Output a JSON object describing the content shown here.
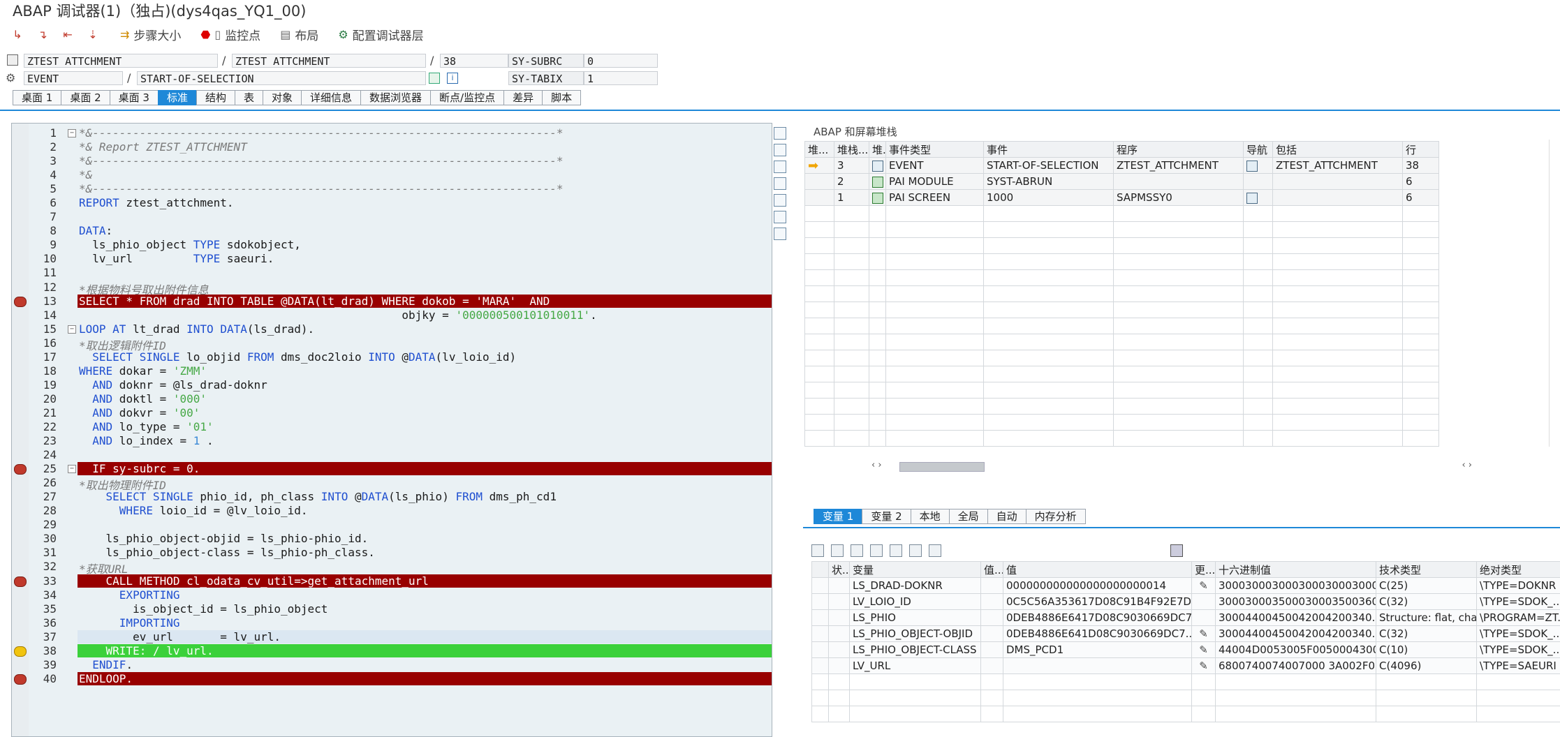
{
  "window": {
    "title": "ABAP 调试器(1)（独占)(dys4qas_YQ1_00)"
  },
  "toolbar": {
    "icons": [
      "step-into-icon",
      "step-over-icon",
      "return-icon",
      "continue-icon"
    ],
    "step_size": "步骤大小",
    "watchpoint": "监控点",
    "layout": "布局",
    "config": "配置调试器层"
  },
  "info": {
    "program1": "ZTEST_ATTCHMENT",
    "program2": "ZTEST_ATTCHMENT",
    "line": "38",
    "subrc_label": "SY-SUBRC",
    "subrc_value": "0",
    "event_type": "EVENT",
    "event": "START-OF-SELECTION",
    "tabix_label": "SY-TABIX",
    "tabix_value": "1"
  },
  "tabs": [
    "桌面 1",
    "桌面 2",
    "桌面 3",
    "标准",
    "结构",
    "表",
    "对象",
    "详细信息",
    "数据浏览器",
    "断点/监控点",
    "差异",
    "脚本"
  ],
  "active_tab": "标准",
  "code": [
    "*&---------------------------------------------------------------------*",
    "*& Report ZTEST_ATTCHMENT",
    "*&---------------------------------------------------------------------*",
    "*&",
    "*&---------------------------------------------------------------------*",
    "REPORT ztest_attchment.",
    "",
    "DATA:",
    "  ls_phio_object TYPE sdokobject,",
    "  lv_url         TYPE saeuri.",
    "",
    "*根据物料号取出附件信息",
    "SELECT * FROM drad INTO TABLE @DATA(lt_drad) WHERE dokob = 'MARA'  AND",
    "                                                objky = '000000500101010011'.",
    "LOOP AT lt_drad INTO DATA(ls_drad).",
    "*取出逻辑附件ID",
    "  SELECT SINGLE lo_objid FROM dms_doc2loio INTO @DATA(lv_loio_id)",
    "WHERE dokar = 'ZMM'",
    "  AND doknr = @ls_drad-doknr",
    "  AND doktl = '000'",
    "  AND dokvr = '00'",
    "  AND lo_type = '01'",
    "  AND lo_index = 1 .",
    "",
    "  IF sy-subrc = 0.",
    "*取出物理附件ID",
    "    SELECT SINGLE phio_id, ph_class INTO @DATA(ls_phio) FROM dms_ph_cd1",
    "      WHERE loio_id = @lv_loio_id.",
    "",
    "    ls_phio_object-objid = ls_phio-phio_id.",
    "    ls_phio_object-class = ls_phio-ph_class.",
    "*获取URL",
    "    CALL METHOD cl_odata_cv_util=>get_attachment_url",
    "      EXPORTING",
    "        is_object_id = ls_phio_object",
    "      IMPORTING",
    "        ev_url       = lv_url.",
    "    WRITE: / lv_url.",
    "  ENDIF.",
    "ENDLOOP."
  ],
  "stack": {
    "title": "ABAP 和屏幕堆栈",
    "headers": [
      "堆...",
      "堆栈...",
      "堆..",
      "事件类型",
      "事件",
      "程序",
      "导航",
      "包括",
      "行"
    ],
    "rows": [
      {
        "level": "3",
        "type": "EVENT",
        "event": "START-OF-SELECTION",
        "program": "ZTEST_ATTCHMENT",
        "include": "ZTEST_ATTCHMENT",
        "line": "38"
      },
      {
        "level": "2",
        "type": "PAI MODULE",
        "event": "SYST-ABRUN",
        "program": "",
        "include": "",
        "line": "6"
      },
      {
        "level": "1",
        "type": "PAI SCREEN",
        "event": "1000",
        "program": "SAPMSSY0",
        "include": "",
        "line": "6"
      }
    ]
  },
  "vartabs": [
    "变量 1",
    "变量 2",
    "本地",
    "全局",
    "自动",
    "内存分析"
  ],
  "active_vartab": "变量 1",
  "vars": {
    "headers": [
      "状...",
      "变量",
      "值...",
      "值",
      "更...",
      "十六进制值",
      "技术类型",
      "绝对类型"
    ],
    "rows": [
      {
        "name": "LS_DRAD-DOKNR",
        "value": "000000000000000000000014",
        "hex": "3000300030003000300030003000...",
        "tech": "C(25)",
        "abs": "\\TYPE=DOKNR"
      },
      {
        "name": "LV_LOIO_ID",
        "value": "0C5C56A353617D08C91B4F92E7D...",
        "hex": "3000300035000300035003600...",
        "tech": "C(32)",
        "abs": "\\TYPE=SDOK_..."
      },
      {
        "name": "LS_PHIO",
        "value": "0DEB4886E6417D08C9030669DC7...",
        "hex": "30004400450042004200340...",
        "tech": "Structure: flat, charl...",
        "abs": "\\PROGRAM=ZT..."
      },
      {
        "name": "LS_PHIO_OBJECT-OBJID",
        "value": "0DEB4886E641D08C9030669DC7...",
        "hex": "30004400450042004200340...",
        "tech": "C(32)",
        "abs": "\\TYPE=SDOK_..."
      },
      {
        "name": "LS_PHIO_OBJECT-CLASS",
        "value": "DMS_PCD1",
        "hex": "44004D0053005F0050004300...",
        "tech": "C(10)",
        "abs": "\\TYPE=SDOK_..."
      },
      {
        "name": "LV_URL",
        "value": "",
        "hex": "6800740074007000 3A002F00...",
        "tech": "C(4096)",
        "abs": "\\TYPE=SAEURI"
      }
    ]
  }
}
